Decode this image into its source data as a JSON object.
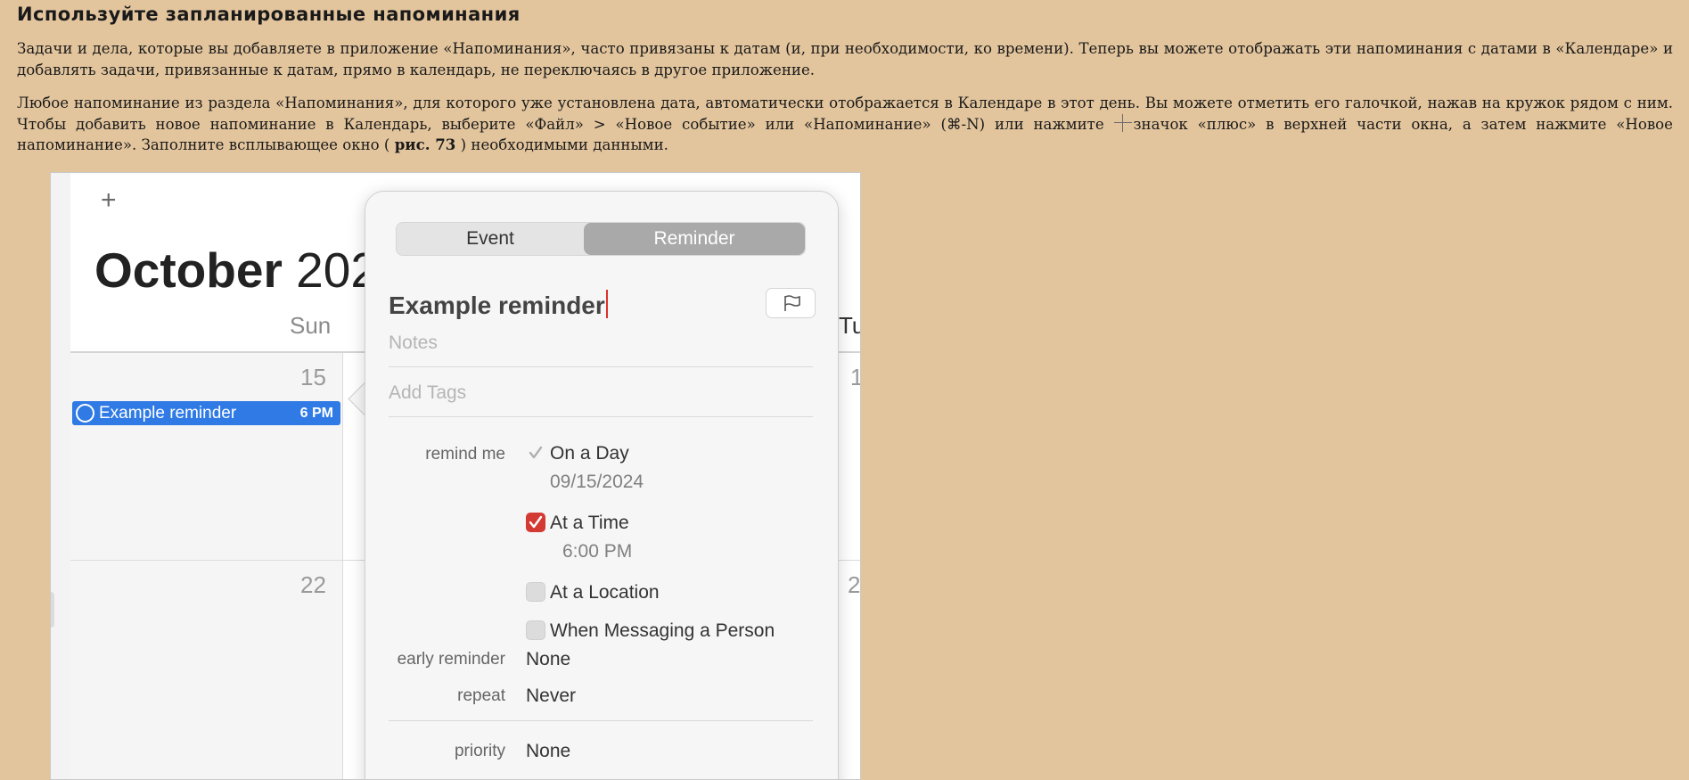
{
  "heading": "Используйте запланированные напоминания",
  "paragraph1": "Задачи и дела, которые вы добавляете в приложение «Напоминания», часто привязаны к датам (и, при необходимости, ко времени). Теперь вы можете отображать эти напоминания с датами в «Календаре» и добавлять задачи, привязанные к датам, прямо в календарь, не переключаясь в другое приложение.",
  "paragraph2": {
    "part1": "Любое напоминание из раздела «Напоминания», для которого уже установлена дата, автоматически отображается в Календаре в этот день. Вы можете отметить его галочкой, нажав на кружок рядом с ним. Чтобы добавить новое напоминание в Календарь, выберите «Файл» > «Новое событие» или «Напоминание» (⌘-N) или нажмите ",
    "part2": "значок «плюс» в верхней части окна, а затем нажмите «Новое напоминание». Заполните всплывающее окно ( ",
    "figure_ref": "рис. 73",
    "part3": " ) необходимыми данными."
  },
  "calendar": {
    "add_symbol": "+",
    "month": "October",
    "year": "202",
    "day_sun": "Sun",
    "day_tue": "Tu",
    "date_15": "15",
    "date_22": "22",
    "date_right1": "1",
    "date_right2": "2",
    "event_title": "Example reminder",
    "event_time": "6 PM"
  },
  "popover": {
    "tab_event": "Event",
    "tab_reminder": "Reminder",
    "title": "Example reminder",
    "notes_placeholder": "Notes",
    "tags_placeholder": "Add Tags",
    "remind_me_label": "remind me",
    "on_a_day_label": "On a Day",
    "on_a_day_checked": true,
    "date_value": "09/15/2024",
    "at_a_time_label": "At a Time",
    "at_a_time_checked": true,
    "time_value": "6:00 PM",
    "at_a_location_label": "At a Location",
    "at_a_location_checked": false,
    "when_messaging_label": "When Messaging a Person",
    "when_messaging_checked": false,
    "early_reminder_label": "early reminder",
    "early_reminder_value": "None",
    "repeat_label": "repeat",
    "repeat_value": "Never",
    "priority_label": "priority",
    "priority_value": "None"
  },
  "icons": {
    "plus": "plus-icon",
    "flag": "flag-icon",
    "check": "checkmark-icon",
    "ring": "reminder-circle-icon"
  },
  "colors": {
    "page_background": "#e3c59d",
    "event_blue": "#2f7ae5",
    "checkbox_red": "#d43a34",
    "caret_red": "#d9342b"
  }
}
